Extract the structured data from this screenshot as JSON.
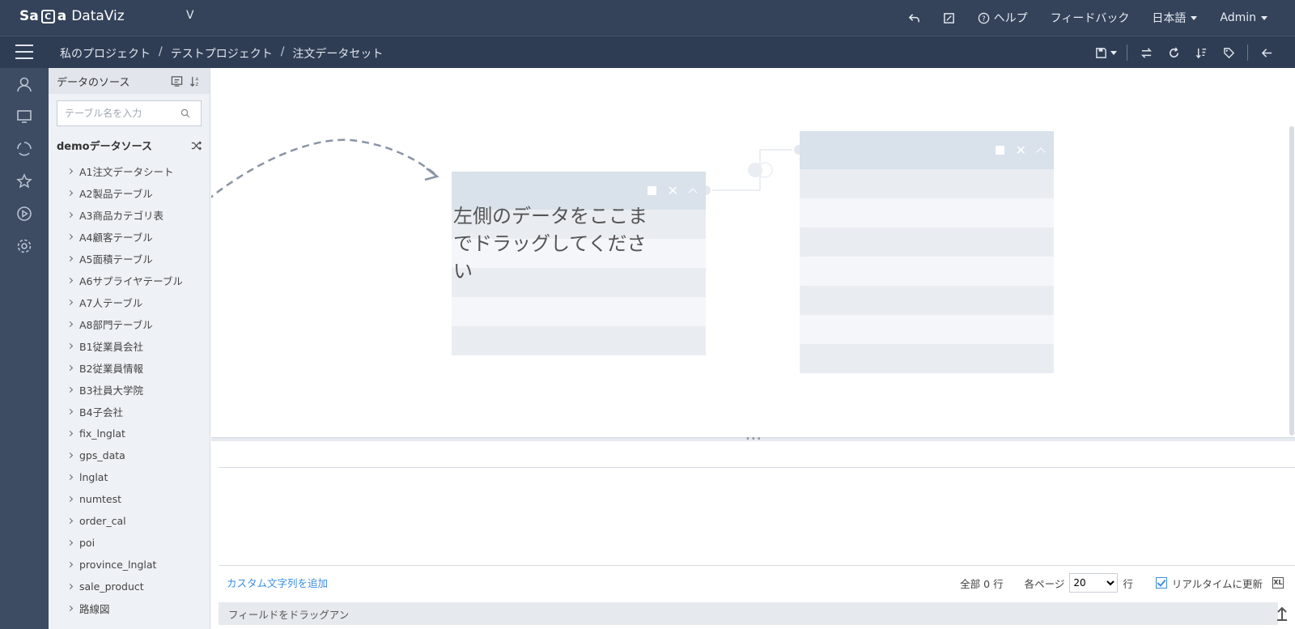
{
  "app": {
    "logo_left": "Sa",
    "logo_mark": "C",
    "logo_right": "a",
    "logo_product": "DataViz",
    "version": "V"
  },
  "topnav": {
    "help_label": "ヘルプ",
    "feedback_label": "フィードバック",
    "language_label": "日本語",
    "user_label": "Admin"
  },
  "breadcrumb": {
    "items": [
      "私のプロジェクト",
      "テストプロジェクト",
      "注文データセット"
    ],
    "separator": "/"
  },
  "panel": {
    "title": "データのソース",
    "search_placeholder": "テーブル名を入力",
    "datasource_name": "demoデータソース",
    "tables": [
      "A1注文データシート",
      "A2製品テーブル",
      "A3商品カテゴリ表",
      "A4顧客テーブル",
      "A5面積テーブル",
      "A6サプライヤテーブル",
      "A7人テーブル",
      "A8部門テーブル",
      "B1従業員会社",
      "B2従業員情報",
      "B3社員大学院",
      "B4子会社",
      "fix_lnglat",
      "gps_data",
      "lnglat",
      "numtest",
      "order_cal",
      "poi",
      "province_lnglat",
      "sale_product",
      "路線図"
    ]
  },
  "canvas": {
    "drop_hint": "左側のデータをここまでドラッグしてください"
  },
  "bottom": {
    "custom_column_link": "カスタム文字列を追加",
    "total_label": "全部 0 行",
    "per_page_label": "各ページ",
    "per_page_value": "20",
    "per_page_unit": "行",
    "realtime_label": "リアルタイムに更新",
    "excel_icon_text": "XL",
    "field_drag_hint": "フィールドをドラッグアン"
  },
  "colors": {
    "header_bg": "#34425a",
    "subbar_bg": "#2f3d54",
    "rail_bg": "#3d4b63",
    "accent": "#3a8ee6"
  },
  "icons": {
    "topnav": [
      "undo-icon",
      "edit-icon",
      "help-icon"
    ],
    "subtools": [
      "save-icon",
      "swap-icon",
      "refresh-icon",
      "sort-icon",
      "tag-icon",
      "back-arrow-icon"
    ],
    "rail": [
      "user-icon",
      "monitor-icon",
      "cycle-icon",
      "star-icon",
      "play-icon",
      "settings-icon"
    ]
  }
}
